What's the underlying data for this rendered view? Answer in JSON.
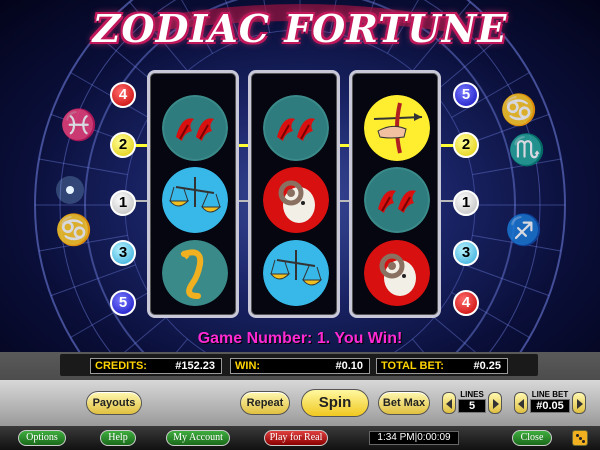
{
  "game": {
    "title": "ZODIAC FORTUNE",
    "message": "Game Number: 1. You Win!"
  },
  "reels": [
    [
      "cancer-icon",
      "libra-icon",
      "scorpio-icon"
    ],
    [
      "cancer-icon",
      "aries-icon",
      "libra-icon"
    ],
    [
      "sagittarius-icon",
      "cancer-icon",
      "aries-icon"
    ]
  ],
  "paylines": {
    "left": [
      "4",
      "2",
      "1",
      "3",
      "5"
    ],
    "right": [
      "5",
      "2",
      "1",
      "3",
      "4"
    ],
    "left_colors": [
      "red",
      "yellow",
      "white",
      "cyan",
      "blue"
    ],
    "right_colors": [
      "blue",
      "yellow",
      "white",
      "cyan",
      "red"
    ],
    "winning_line": "2"
  },
  "readouts": {
    "credits_label": "CREDITS:",
    "credits_value": "#152.23",
    "win_label": "WIN:",
    "win_value": "#0.10",
    "total_bet_label": "TOTAL BET:",
    "total_bet_value": "#0.25"
  },
  "controls": {
    "payouts": "Payouts",
    "repeat": "Repeat",
    "spin": "Spin",
    "bet_max": "Bet Max",
    "lines_label": "LINES",
    "lines_value": "5",
    "line_bet_label": "LINE BET",
    "line_bet_value": "#0.05"
  },
  "footer": {
    "options": "Options",
    "help": "Help",
    "my_account": "My Account",
    "play_for_real": "Play for Real",
    "clock": "1:34 PM|0:00:09",
    "close": "Close"
  },
  "colors": {
    "accent_magenta": "#ff2ad4",
    "payline": "#ffff33",
    "button_gold": "#f0c820",
    "footer_green": "#1a6a1a"
  }
}
